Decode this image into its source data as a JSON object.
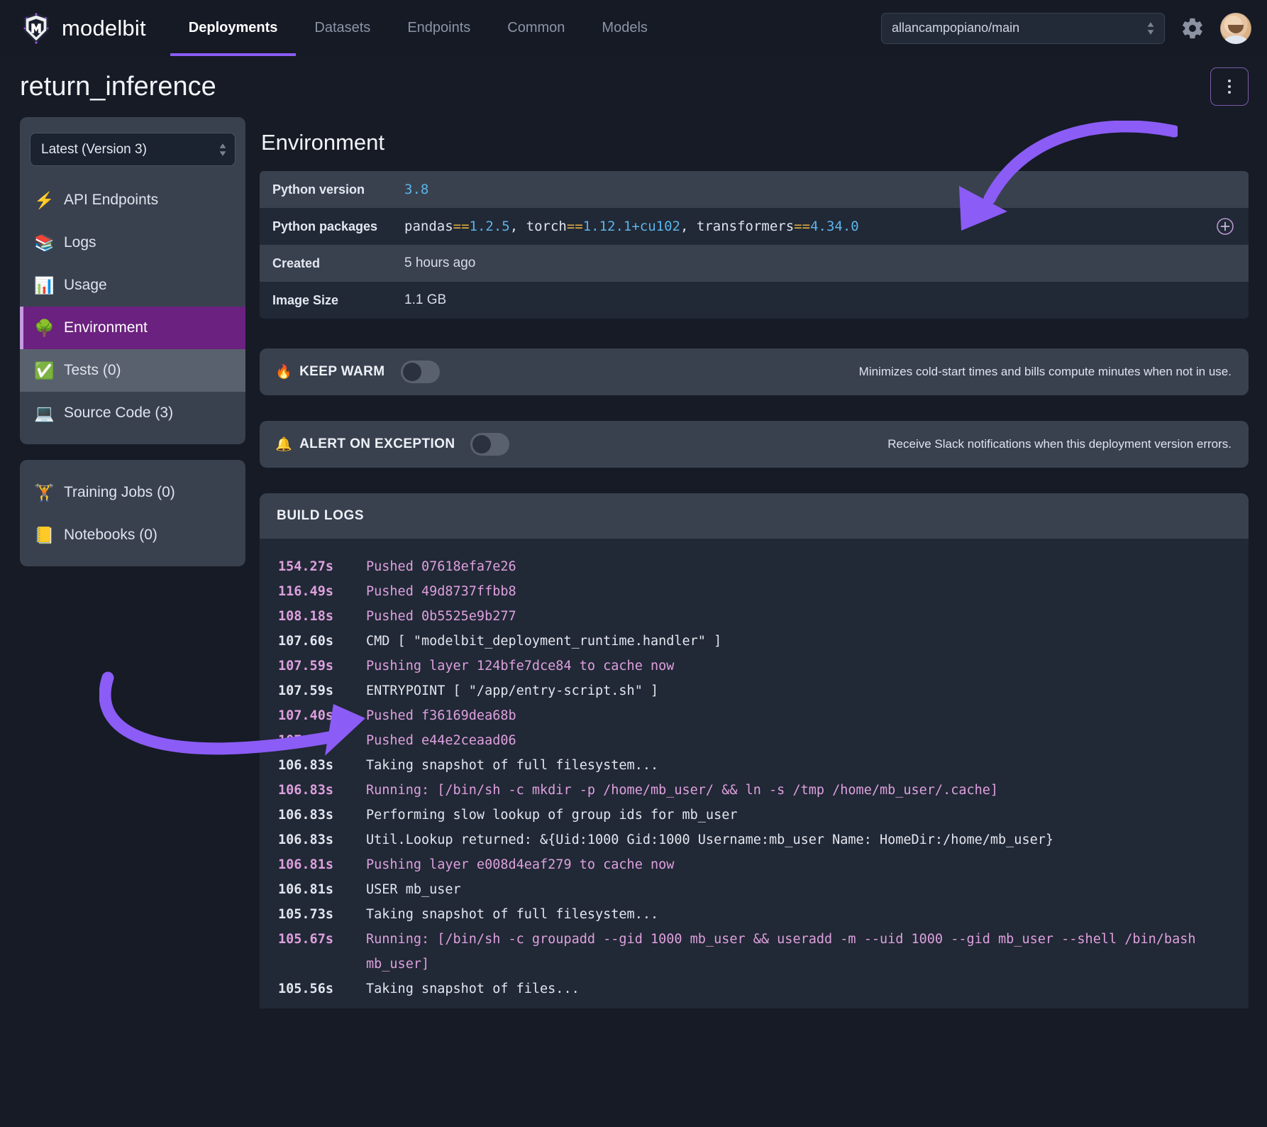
{
  "brand": {
    "name": "modelbit",
    "logo_icon": "modelbit-logo-icon"
  },
  "topnav": {
    "tabs": [
      {
        "label": "Deployments",
        "active": true
      },
      {
        "label": "Datasets",
        "active": false
      },
      {
        "label": "Endpoints",
        "active": false
      },
      {
        "label": "Common",
        "active": false
      },
      {
        "label": "Models",
        "active": false
      }
    ],
    "repo_select": {
      "value": "allancampopiano/main"
    },
    "gear_icon": "gear-icon",
    "avatar_icon": "user-avatar"
  },
  "page": {
    "title": "return_inference",
    "kebab_icon": "more-options-icon"
  },
  "sidebar": {
    "version_select": {
      "value": "Latest (Version 3)"
    },
    "primary_items": [
      {
        "emoji": "⚡",
        "label": "API Endpoints",
        "name": "api-endpoints",
        "state": ""
      },
      {
        "emoji": "📚",
        "label": "Logs",
        "name": "logs",
        "state": ""
      },
      {
        "emoji": "📊",
        "label": "Usage",
        "name": "usage",
        "state": ""
      },
      {
        "emoji": "🌳",
        "label": "Environment",
        "name": "environment",
        "state": "active"
      },
      {
        "emoji": "✅",
        "label": "Tests (0)",
        "name": "tests",
        "state": "hover"
      },
      {
        "emoji": "💻",
        "label": "Source Code (3)",
        "name": "source-code",
        "state": ""
      }
    ],
    "secondary_items": [
      {
        "emoji": "🏋️",
        "label": "Training Jobs (0)",
        "name": "training-jobs",
        "state": ""
      },
      {
        "emoji": "📒",
        "label": "Notebooks (0)",
        "name": "notebooks",
        "state": ""
      }
    ]
  },
  "environment": {
    "heading": "Environment",
    "rows": [
      {
        "key": "Python version",
        "value": "3.8",
        "kind": "version"
      },
      {
        "key": "Python packages",
        "value": "pandas==1.2.5, torch==1.12.1+cu102, transformers==4.34.0",
        "kind": "packages",
        "add_icon": "add-package-icon"
      },
      {
        "key": "Created",
        "value": "5 hours ago",
        "kind": "text"
      },
      {
        "key": "Image Size",
        "value": "1.1 GB",
        "kind": "text"
      }
    ],
    "packages": [
      {
        "name": "pandas",
        "op": "==",
        "version": "1.2.5",
        "sep": ", "
      },
      {
        "name": "torch",
        "op": "==",
        "version": "1.12.1+cu102",
        "sep": ", "
      },
      {
        "name": "transformers",
        "op": "==",
        "version": "4.34.0",
        "sep": ""
      }
    ]
  },
  "keep_warm": {
    "icon": "🔥",
    "label": "KEEP WARM",
    "enabled": false,
    "description": "Minimizes cold-start times and bills compute minutes when not in use."
  },
  "alert_on_exception": {
    "icon": "🔔",
    "label": "ALERT ON EXCEPTION",
    "enabled": false,
    "description": "Receive Slack notifications when this deployment version errors."
  },
  "build_logs": {
    "heading": "BUILD LOGS",
    "lines": [
      {
        "time": "154.27s",
        "message": "Pushed 07618efa7e26",
        "level": "pink"
      },
      {
        "time": "116.49s",
        "message": "Pushed 49d8737ffbb8",
        "level": "pink"
      },
      {
        "time": "108.18s",
        "message": "Pushed 0b5525e9b277",
        "level": "pink"
      },
      {
        "time": "107.60s",
        "message": "CMD [ \"modelbit_deployment_runtime.handler\" ]",
        "level": "white"
      },
      {
        "time": "107.59s",
        "message": "Pushing layer 124bfe7dce84 to cache now",
        "level": "pink"
      },
      {
        "time": "107.59s",
        "message": "ENTRYPOINT [ \"/app/entry-script.sh\" ]",
        "level": "white"
      },
      {
        "time": "107.40s",
        "message": "Pushed f36169dea68b",
        "level": "pink"
      },
      {
        "time": "107.26s",
        "message": "Pushed e44e2ceaad06",
        "level": "pink"
      },
      {
        "time": "106.83s",
        "message": "Taking snapshot of full filesystem...",
        "level": "white"
      },
      {
        "time": "106.83s",
        "message": "Running: [/bin/sh -c mkdir -p /home/mb_user/ && ln -s /tmp /home/mb_user/.cache]",
        "level": "pink"
      },
      {
        "time": "106.83s",
        "message": "Performing slow lookup of group ids for mb_user",
        "level": "white"
      },
      {
        "time": "106.83s",
        "message": "Util.Lookup returned: &{Uid:1000 Gid:1000 Username:mb_user Name: HomeDir:/home/mb_user}",
        "level": "white"
      },
      {
        "time": "106.81s",
        "message": "Pushing layer e008d4eaf279 to cache now",
        "level": "pink"
      },
      {
        "time": "106.81s",
        "message": "USER mb_user",
        "level": "white"
      },
      {
        "time": "105.73s",
        "message": "Taking snapshot of full filesystem...",
        "level": "white"
      },
      {
        "time": "105.67s",
        "message": "Running: [/bin/sh -c groupadd --gid 1000 mb_user && useradd -m --uid 1000 --gid mb_user --shell /bin/bash mb_user]",
        "level": "pink"
      },
      {
        "time": "105.56s",
        "message": "Taking snapshot of files...",
        "level": "white"
      }
    ]
  },
  "annotations": {
    "arrow_color": "#8b5cf6",
    "arrow_top_target": "python-packages-row",
    "arrow_bottom_target": "entrypoint-log-line"
  }
}
